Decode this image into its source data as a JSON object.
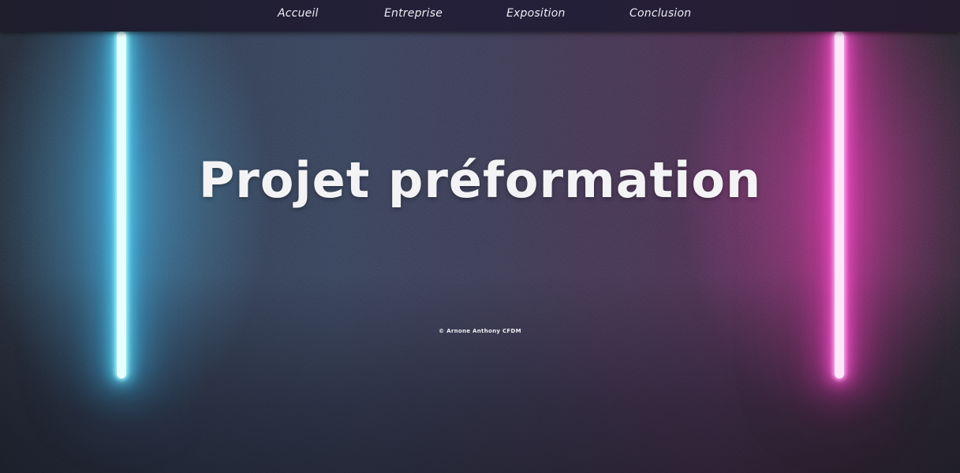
{
  "nav": {
    "items": [
      {
        "label": "Accueil"
      },
      {
        "label": "Entreprise"
      },
      {
        "label": "Exposition"
      },
      {
        "label": "Conclusion"
      }
    ]
  },
  "hero": {
    "title": "Projet préformation",
    "credit": "© Arnone Anthony CFDM"
  },
  "colors": {
    "navbar": "#1e1e2d",
    "neon_left": "#55d2f0",
    "neon_right": "#f050c8",
    "text": "#f3f3f5"
  }
}
